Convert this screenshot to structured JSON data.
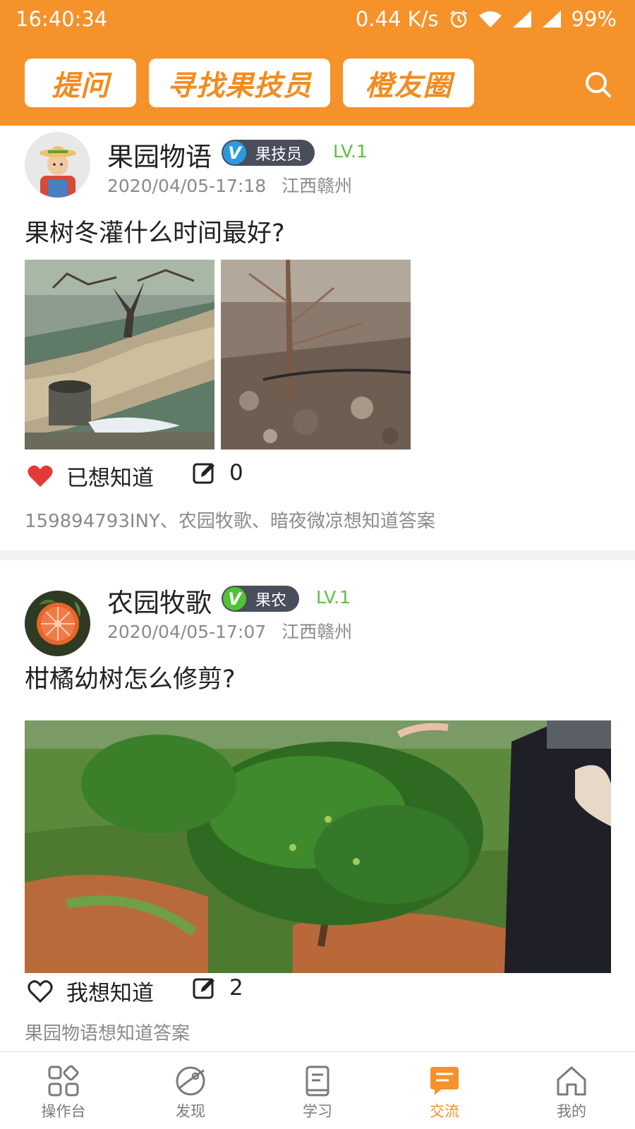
{
  "status_bar": {
    "time": "16:40:34",
    "network_speed": "0.44 K/s",
    "battery": "99%",
    "icons": [
      "alarm-icon",
      "wifi-icon",
      "signal-icon",
      "signal-icon",
      "battery-label"
    ]
  },
  "header": {
    "buttons": [
      "提问",
      "寻找果技员",
      "橙友圈"
    ],
    "search_icon": "search-icon"
  },
  "posts": [
    {
      "user_name": "果园物语",
      "role": "果技员",
      "role_color": "#2b9ae0",
      "level": "LV.1",
      "timestamp": "2020/04/05-17:18",
      "location": "江西赣州",
      "question": "果树冬灌什么时间最好?",
      "images": [
        "orchard-irrigation-photo",
        "young-tree-soil-photo"
      ],
      "want_label": "已想知道",
      "want_active": true,
      "answer_count": "0",
      "watchers_text": "159894793INY、农园牧歌、暗夜微凉想知道答案"
    },
    {
      "user_name": "农园牧歌",
      "role": "果农",
      "role_color": "#52c234",
      "level": "LV.1",
      "timestamp": "2020/04/05-17:07",
      "location": "江西赣州",
      "question": "柑橘幼树怎么修剪?",
      "images": [
        "citrus-young-tree-photo"
      ],
      "want_label": "我想知道",
      "want_active": false,
      "answer_count": "2",
      "watchers_text": "果园物语想知道答案"
    }
  ],
  "bottom_nav": {
    "items": [
      {
        "label": "操作台",
        "icon": "grid-icon"
      },
      {
        "label": "发现",
        "icon": "planet-icon"
      },
      {
        "label": "学习",
        "icon": "book-icon"
      },
      {
        "label": "交流",
        "icon": "chat-icon"
      },
      {
        "label": "我的",
        "icon": "home-icon"
      }
    ],
    "active": "交流",
    "active_color": "#f5922a"
  }
}
